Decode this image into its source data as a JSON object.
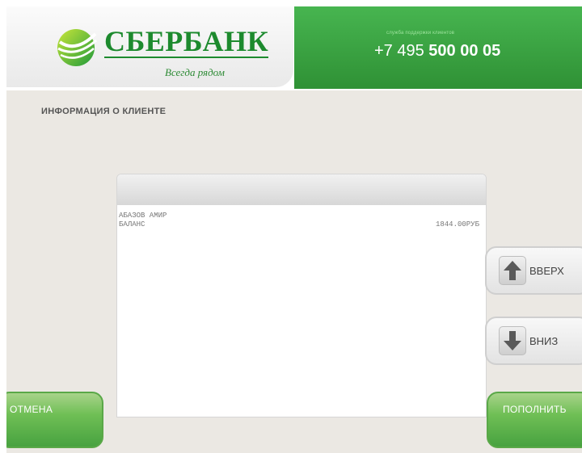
{
  "header": {
    "brand_name": "СБЕРБАНК",
    "slogan": "Всегда рядом",
    "hotline_caption": "служба поддержки клиентов",
    "phone_prefix": "+7 495 ",
    "phone_main": "500 00 05"
  },
  "page": {
    "title": "ИНФОРМАЦИЯ О КЛИЕНТЕ"
  },
  "receipt": {
    "client_name": "АБАЗОВ АМИР",
    "balance_label": "БАЛАНС",
    "balance_value": "1844.00РУБ"
  },
  "buttons": {
    "up_label": "ВВЕРХ",
    "down_label": "ВНИЗ",
    "cancel_label": "ОТМЕНА",
    "topup_label": "ПОПОЛНИТЬ"
  },
  "colors": {
    "brand_green": "#1d8a2e",
    "header_green": "#3aa343",
    "button_green": "#6fbf55",
    "background": "#ebe8e3"
  },
  "icons": {
    "logo": "sberbank-logo-icon",
    "up": "arrow-up-icon",
    "down": "arrow-down-icon"
  }
}
